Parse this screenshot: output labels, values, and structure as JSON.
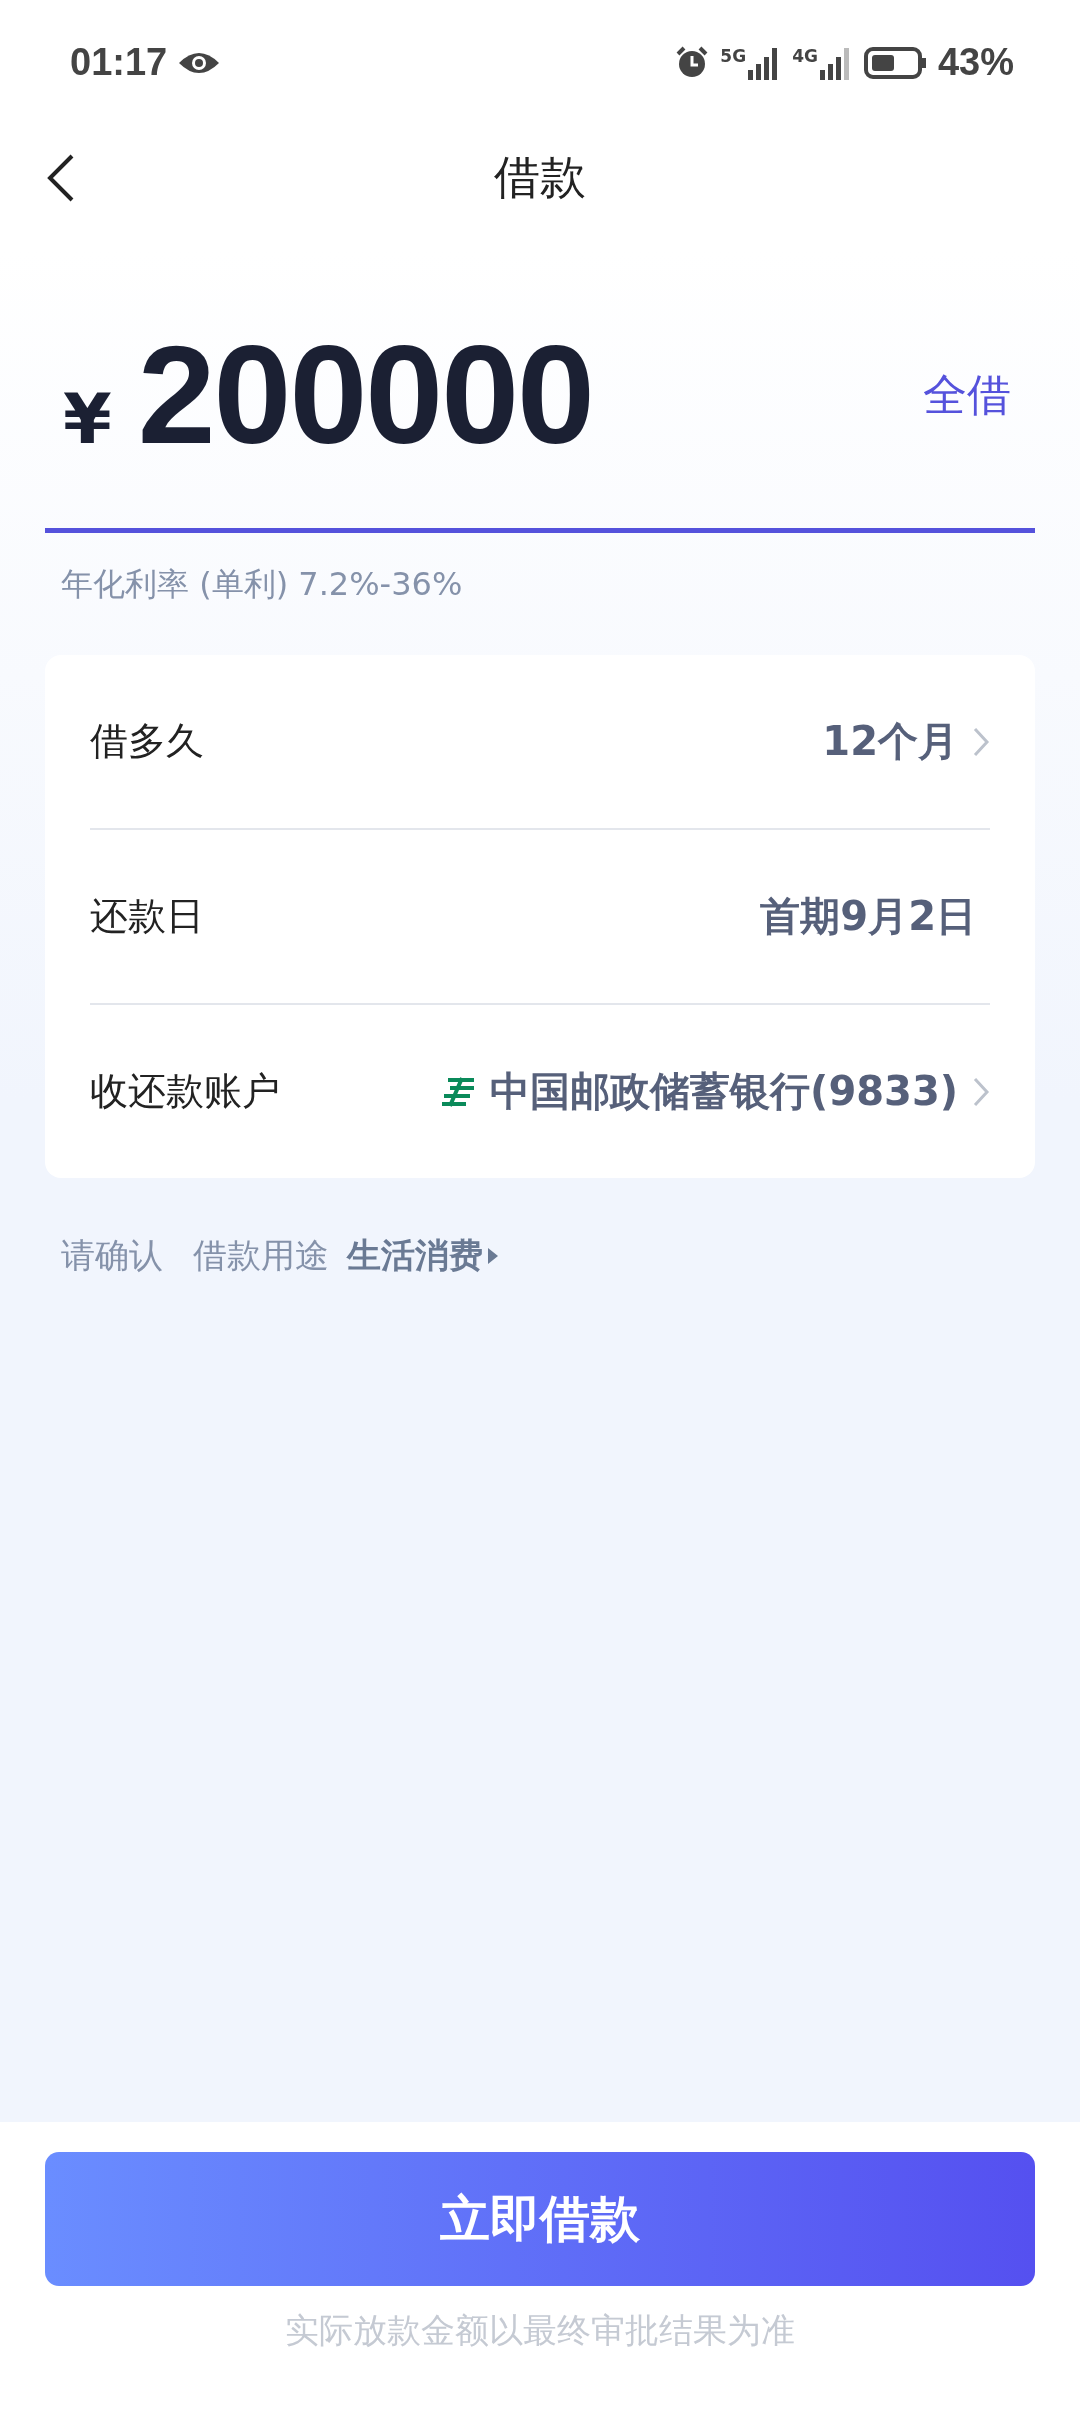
{
  "status_bar": {
    "time": "01:17",
    "network_1": "5G",
    "network_2": "4G",
    "battery": "43%"
  },
  "nav": {
    "title": "借款"
  },
  "amount": {
    "currency": "¥",
    "value": "200000",
    "action": "全借"
  },
  "rate_note": "年化利率 (单利) 7.2%-36%",
  "rows": [
    {
      "label": "借多久",
      "value": "12个月",
      "kind": "select"
    },
    {
      "label": "还款日",
      "value": "首期9月2日",
      "kind": "info"
    },
    {
      "label": "收还款账户",
      "value": "中国邮政储蓄银行(9833)",
      "kind": "account"
    }
  ],
  "purpose": {
    "prefix": "请确认",
    "label": "借款用途",
    "value": "生活消费"
  },
  "submit": "立即借款",
  "footnote": "实际放款金额以最终审批结果为准"
}
